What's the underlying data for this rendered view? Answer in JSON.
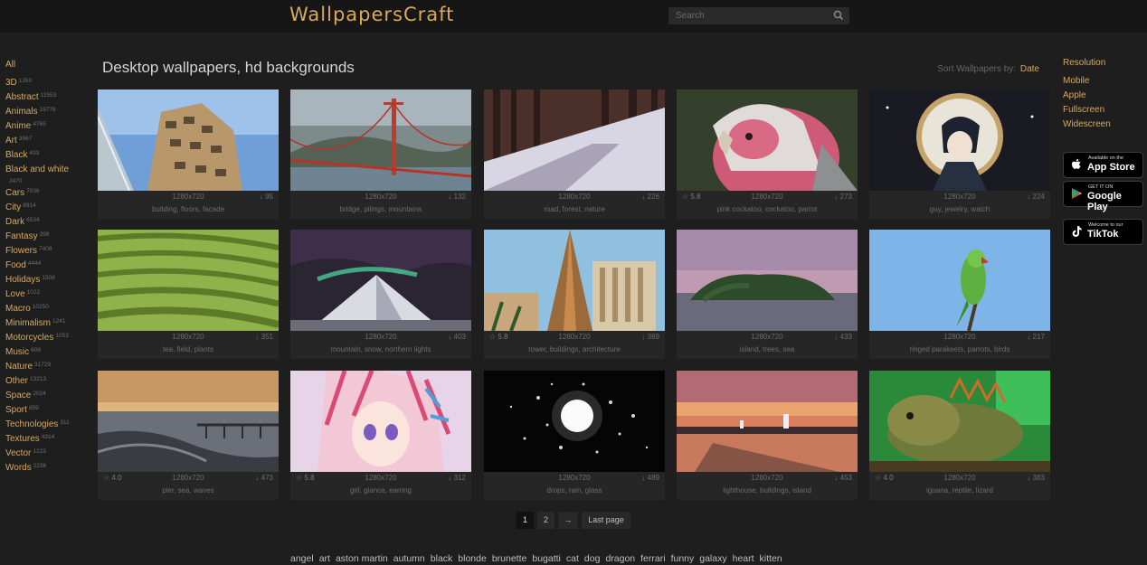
{
  "header": {
    "logo": "WallpapersCraft",
    "search_placeholder": "Search"
  },
  "sidebar": {
    "all_label": "All",
    "categories": [
      {
        "label": "3D",
        "count": "1350"
      },
      {
        "label": "Abstract",
        "count": "11553"
      },
      {
        "label": "Animals",
        "count": "16778"
      },
      {
        "label": "Anime",
        "count": "4765"
      },
      {
        "label": "Art",
        "count": "3967"
      },
      {
        "label": "Black",
        "count": "433"
      },
      {
        "label": "Black and white",
        "count": "2470"
      },
      {
        "label": "Cars",
        "count": "7036"
      },
      {
        "label": "City",
        "count": "8914"
      },
      {
        "label": "Dark",
        "count": "6534"
      },
      {
        "label": "Fantasy",
        "count": "399"
      },
      {
        "label": "Flowers",
        "count": "7408"
      },
      {
        "label": "Food",
        "count": "4444"
      },
      {
        "label": "Holidays",
        "count": "1508"
      },
      {
        "label": "Love",
        "count": "1022"
      },
      {
        "label": "Macro",
        "count": "10250"
      },
      {
        "label": "Minimalism",
        "count": "1241"
      },
      {
        "label": "Motorcycles",
        "count": "1053"
      },
      {
        "label": "Music",
        "count": "608"
      },
      {
        "label": "Nature",
        "count": "31729"
      },
      {
        "label": "Other",
        "count": "13213"
      },
      {
        "label": "Space",
        "count": "2024"
      },
      {
        "label": "Sport",
        "count": "859"
      },
      {
        "label": "Technologies",
        "count": "311"
      },
      {
        "label": "Textures",
        "count": "4314"
      },
      {
        "label": "Vector",
        "count": "1223"
      },
      {
        "label": "Words",
        "count": "2236"
      }
    ]
  },
  "main": {
    "title": "Desktop wallpapers, hd backgrounds",
    "sort_prefix": "Sort Wallpapers by:",
    "sort_value": "Date",
    "wallpapers": [
      {
        "res": "1280x720",
        "downloads": "95",
        "rating": "",
        "tags": "building, floors, facade"
      },
      {
        "res": "1280x720",
        "downloads": "132",
        "rating": "",
        "tags": "bridge, pilings, mountains"
      },
      {
        "res": "1280x720",
        "downloads": "226",
        "rating": "",
        "tags": "road, forest, nature"
      },
      {
        "res": "1280x720",
        "downloads": "273",
        "rating": "5.8",
        "tags": "pink cockatoo, cockatoo, parrot"
      },
      {
        "res": "1280x720",
        "downloads": "224",
        "rating": "",
        "tags": "guy, jewelry, watch"
      },
      {
        "res": "1280x720",
        "downloads": "351",
        "rating": "",
        "tags": "tea, field, plants"
      },
      {
        "res": "1280x720",
        "downloads": "403",
        "rating": "",
        "tags": "mountain, snow, northern lights"
      },
      {
        "res": "1280x720",
        "downloads": "369",
        "rating": "5.8",
        "tags": "tower, buildings, architecture"
      },
      {
        "res": "1280x720",
        "downloads": "433",
        "rating": "",
        "tags": "island, trees, sea"
      },
      {
        "res": "1280x720",
        "downloads": "217",
        "rating": "",
        "tags": "ringed parakeets, parrots, birds"
      },
      {
        "res": "1280x720",
        "downloads": "473",
        "rating": "4.0",
        "tags": "pier, sea, waves"
      },
      {
        "res": "1280x720",
        "downloads": "312",
        "rating": "5.8",
        "tags": "girl, glance, earring"
      },
      {
        "res": "1280x720",
        "downloads": "489",
        "rating": "",
        "tags": "drops, rain, glass"
      },
      {
        "res": "1280x720",
        "downloads": "453",
        "rating": "",
        "tags": "lighthouse, buildings, island"
      },
      {
        "res": "1280x720",
        "downloads": "383",
        "rating": "4.0",
        "tags": "iguana, reptile, lizard"
      }
    ],
    "pagination": {
      "page1": "1",
      "page2": "2",
      "next": "→",
      "last": "Last page"
    },
    "popular_tags": [
      "angel",
      "art",
      "aston martin",
      "autumn",
      "black",
      "blonde",
      "brunette",
      "bugatti",
      "cat",
      "dog",
      "dragon",
      "ferrari",
      "funny",
      "galaxy",
      "heart",
      "kitten"
    ]
  },
  "right_sidebar": {
    "resolution_title": "Resolution",
    "items": [
      "Mobile",
      "Apple",
      "Fullscreen",
      "Widescreen"
    ],
    "app_store": {
      "small": "Available on the",
      "big": "App Store"
    },
    "google_play": {
      "small": "GET IT ON",
      "big": "Google Play"
    },
    "tiktok": {
      "small": "Welcome to our",
      "big": "TikTok"
    }
  },
  "colors": {
    "accent": "#d8a95a",
    "background": "#1e1e1e",
    "topbar": "#161616",
    "card": "#262626"
  }
}
